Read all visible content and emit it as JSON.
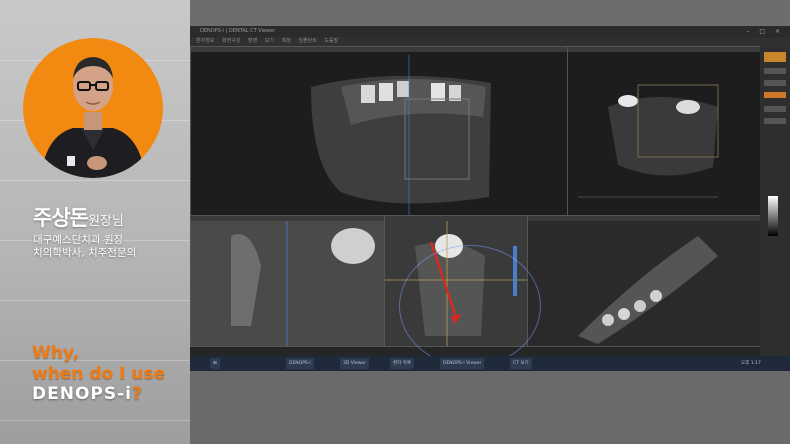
{
  "presenter": {
    "name": "주상돈",
    "title_suffix": "원장님",
    "line1": "대구예스단치과 원장",
    "line2": "치의학박사, 치주전문의"
  },
  "slogan": {
    "line1": "Why,",
    "line2": "when do I use",
    "brand": "DENOPS-i",
    "mark": "?"
  },
  "viewer": {
    "title": "DENOPS-i  |  DENTAL CT Viewer",
    "menus": [
      "환자정보",
      "화면구성",
      "촬영",
      "보기",
      "측정",
      "임플란트",
      "도움말"
    ],
    "taskbar_items": [
      "DENOPS-i",
      "3D Viewer",
      "환자 목록",
      "DENOPS-i Viewer",
      "CT 보기"
    ],
    "clock": "오후 1:17"
  },
  "colors": {
    "accent": "#f07a12",
    "arrow": "#e0261a",
    "highlight": "#4a7fd0"
  }
}
